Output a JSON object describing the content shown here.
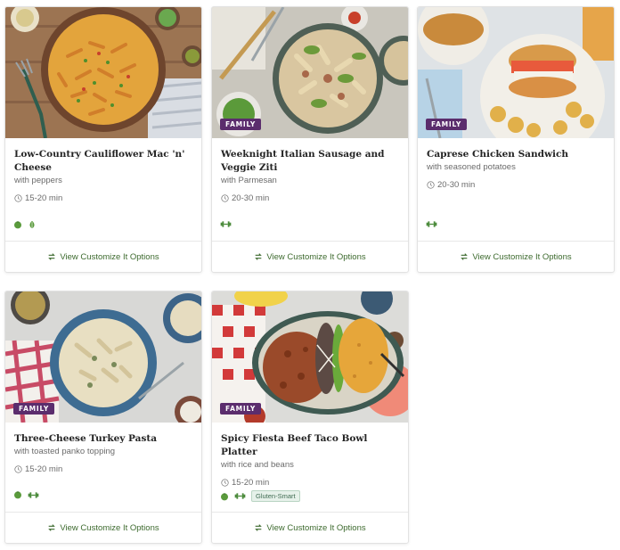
{
  "cards": [
    {
      "title": "Low-Country Cauliflower Mac 'n' Cheese",
      "subtitle": "with peppers",
      "time": "15-20 min",
      "badge": "",
      "tags": [
        "veggie-icon",
        "dietary-leaf-icon"
      ],
      "pill": "",
      "cta": "View Customize It Options"
    },
    {
      "title": "Weeknight Italian Sausage and Veggie Ziti",
      "subtitle": "with Parmesan",
      "time": "20-30 min",
      "badge": "FAMILY",
      "tags": [
        "protein-dumbbell-icon"
      ],
      "pill": "",
      "cta": "View Customize It Options"
    },
    {
      "title": "Caprese Chicken Sandwich",
      "subtitle": "with seasoned potatoes",
      "time": "20-30 min",
      "badge": "FAMILY",
      "tags": [
        "protein-dumbbell-icon"
      ],
      "pill": "",
      "cta": "View Customize It Options"
    },
    {
      "title": "Three-Cheese Turkey Pasta",
      "subtitle": "with toasted panko topping",
      "time": "15-20 min",
      "badge": "FAMILY",
      "tags": [
        "veggie-icon",
        "protein-dumbbell-icon"
      ],
      "pill": "",
      "cta": "View Customize It Options"
    },
    {
      "title": "Spicy Fiesta Beef Taco Bowl Platter",
      "subtitle": "with rice and beans",
      "time": "15-20 min",
      "badge": "FAMILY",
      "tags": [
        "veggie-icon",
        "protein-dumbbell-icon"
      ],
      "pill": "Gluten-Smart",
      "cta": "View Customize It Options"
    }
  ],
  "colors": {
    "badge_bg": "#5b2d6d",
    "cta_text": "#3d6a2e",
    "icon_green": "#4a8a3a",
    "pill_bg": "#e6f1ea"
  }
}
